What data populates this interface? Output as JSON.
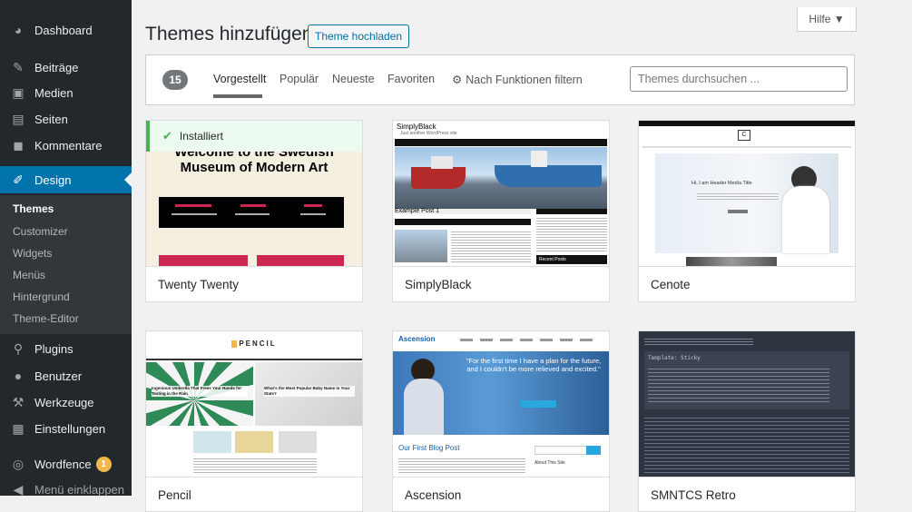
{
  "sidebar": {
    "items": [
      {
        "label": "Dashboard",
        "icon": "dashboard-icon"
      },
      {
        "label": "Beiträge",
        "icon": "pushpin-icon"
      },
      {
        "label": "Medien",
        "icon": "media-icon"
      },
      {
        "label": "Seiten",
        "icon": "pages-icon"
      },
      {
        "label": "Kommentare",
        "icon": "comments-icon"
      },
      {
        "label": "Design",
        "icon": "brush-icon"
      },
      {
        "label": "Plugins",
        "icon": "plugins-icon"
      },
      {
        "label": "Benutzer",
        "icon": "users-icon"
      },
      {
        "label": "Werkzeuge",
        "icon": "wrench-icon"
      },
      {
        "label": "Einstellungen",
        "icon": "settings-icon"
      },
      {
        "label": "Wordfence",
        "icon": "wordfence-icon",
        "badge": "1"
      },
      {
        "label": "Menü einklappen",
        "icon": "collapse-icon"
      }
    ],
    "submenu": [
      "Themes",
      "Customizer",
      "Widgets",
      "Menüs",
      "Hintergrund",
      "Theme-Editor"
    ]
  },
  "header": {
    "title": "Themes hinzufügen",
    "upload_label": "Theme hochladen",
    "help_label": "Hilfe ▼"
  },
  "filter": {
    "count": "15",
    "tabs": [
      "Vorgestellt",
      "Populär",
      "Neueste",
      "Favoriten"
    ],
    "feature_filter": "Nach Funktionen filtern",
    "search_placeholder": "Themes durchsuchen ..."
  },
  "themes": [
    {
      "name": "Twenty Twenty",
      "installed": true,
      "installed_label": "Installiert",
      "preview": {
        "headline1": "Welcome to the Swedish",
        "headline2": "Museum of Modern Art"
      }
    },
    {
      "name": "SimplyBlack",
      "preview": {
        "site_title": "SimplyBlack",
        "tagline": "Just another WordPress site",
        "post": "Example Post 1",
        "widget": "Recent Posts"
      }
    },
    {
      "name": "Cenote",
      "preview": {
        "logo": "C",
        "hero": "Hi, I am Header Media Title"
      }
    },
    {
      "name": "Pencil",
      "preview": {
        "logo": "PENCIL",
        "caption1": "Ingenious Umbrella That Frees Your Hands for Texting in the Rain",
        "caption2": "What's the Most Popular Baby Name in Your State?"
      }
    },
    {
      "name": "Ascension",
      "preview": {
        "logo": "Ascension",
        "quote": "\"For the first time I have a plan for the future, and I couldn't be more relieved and excited.\"",
        "post": "Our First Blog Post",
        "side": "About This Site"
      }
    },
    {
      "name": "SMNTCS Retro",
      "preview": {
        "title": "Template: Sticky"
      }
    }
  ],
  "colors": {
    "sidebar_bg": "#23282d",
    "accent": "#0073aa",
    "installed": "#46b450"
  }
}
